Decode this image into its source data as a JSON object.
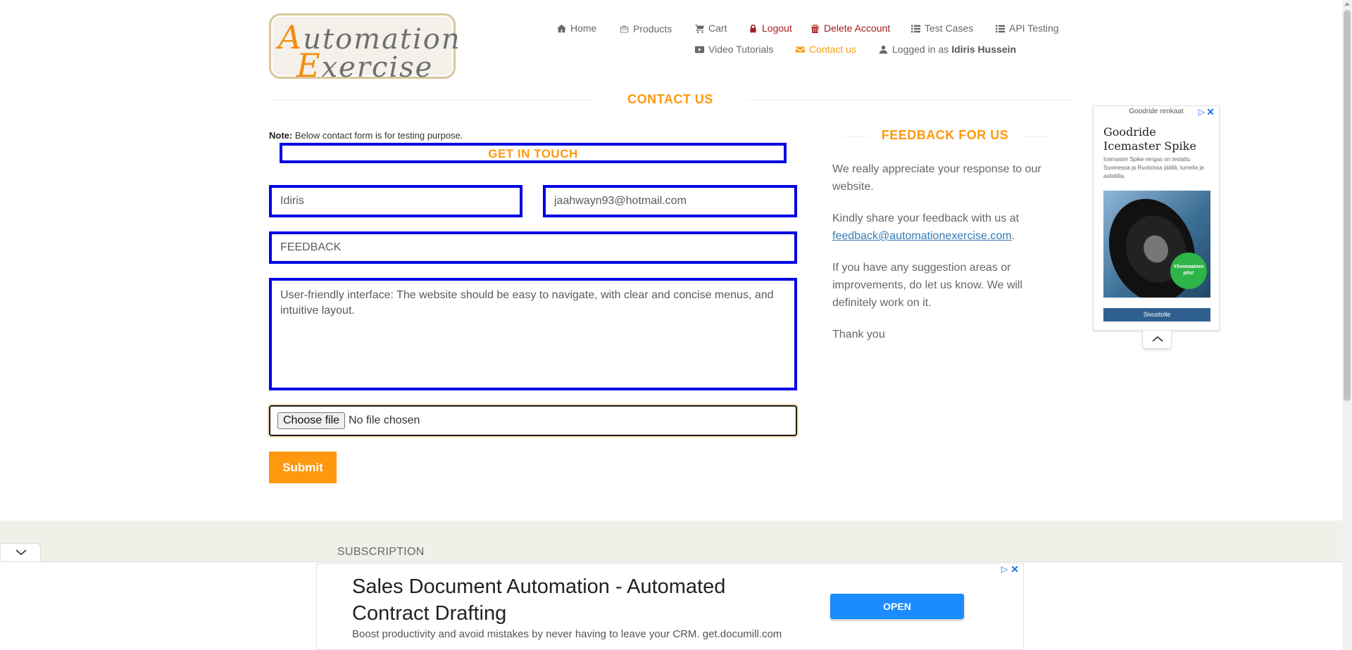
{
  "logo": {
    "line1_cap": "A",
    "line1_rest": "utomation",
    "line2_cap": "E",
    "line2_rest": "xercise"
  },
  "nav": {
    "home": "Home",
    "products": "Products",
    "cart": "Cart",
    "logout": "Logout",
    "delete_account": "Delete Account",
    "test_cases": "Test Cases",
    "api_testing": "API Testing",
    "video_tutorials": "Video Tutorials",
    "contact_us": "Contact us",
    "logged_in_prefix": "Logged in as",
    "logged_in_user": "Idiris Hussein"
  },
  "contact": {
    "title": "CONTACT US",
    "note_label": "Note:",
    "note_text": "Below contact form is for testing purpose.",
    "form_title": "GET IN TOUCH",
    "name_value": "Idiris",
    "email_value": "jaahwayn93@hotmail.com",
    "subject_value": "FEEDBACK",
    "message_value": "User-friendly interface: The website should be easy to navigate, with clear and concise menus, and intuitive layout.",
    "choose_file_label": "Choose file",
    "file_status": "No file chosen",
    "submit_label": "Submit"
  },
  "feedback": {
    "title": "FEEDBACK FOR US",
    "p1": "We really appreciate your response to our website.",
    "p2_prefix": "Kindly share your feedback with us at",
    "p2_email": "feedback@automationexercise.com",
    "p2_suffix": ".",
    "p3": "If you have any suggestion areas or improvements, do let us know. We will definitely work on it.",
    "p4": "Thank you"
  },
  "right_ad": {
    "advertiser": "Goodride renkaat",
    "headline": "Goodride Icemaster Spike",
    "subtext": "Icemaster Spike rengas on testattu Suomessa ja Ruotsissa jäällä, lumella ja asfaltilla.",
    "badge": "Ylivoimainen pito!",
    "button": "Sivustolle"
  },
  "footer": {
    "subscription": "SUBSCRIPTION"
  },
  "bottom_ad": {
    "headline": "Sales Document Automation - Automated Contract Drafting",
    "description": "Boost productivity and avoid mistakes by never having to leave your CRM. get.documill.com",
    "open_label": "OPEN"
  },
  "colors": {
    "accent": "#fe980f",
    "outline": "#0000e6",
    "danger": "#a31d1d",
    "link": "#337ab7"
  }
}
